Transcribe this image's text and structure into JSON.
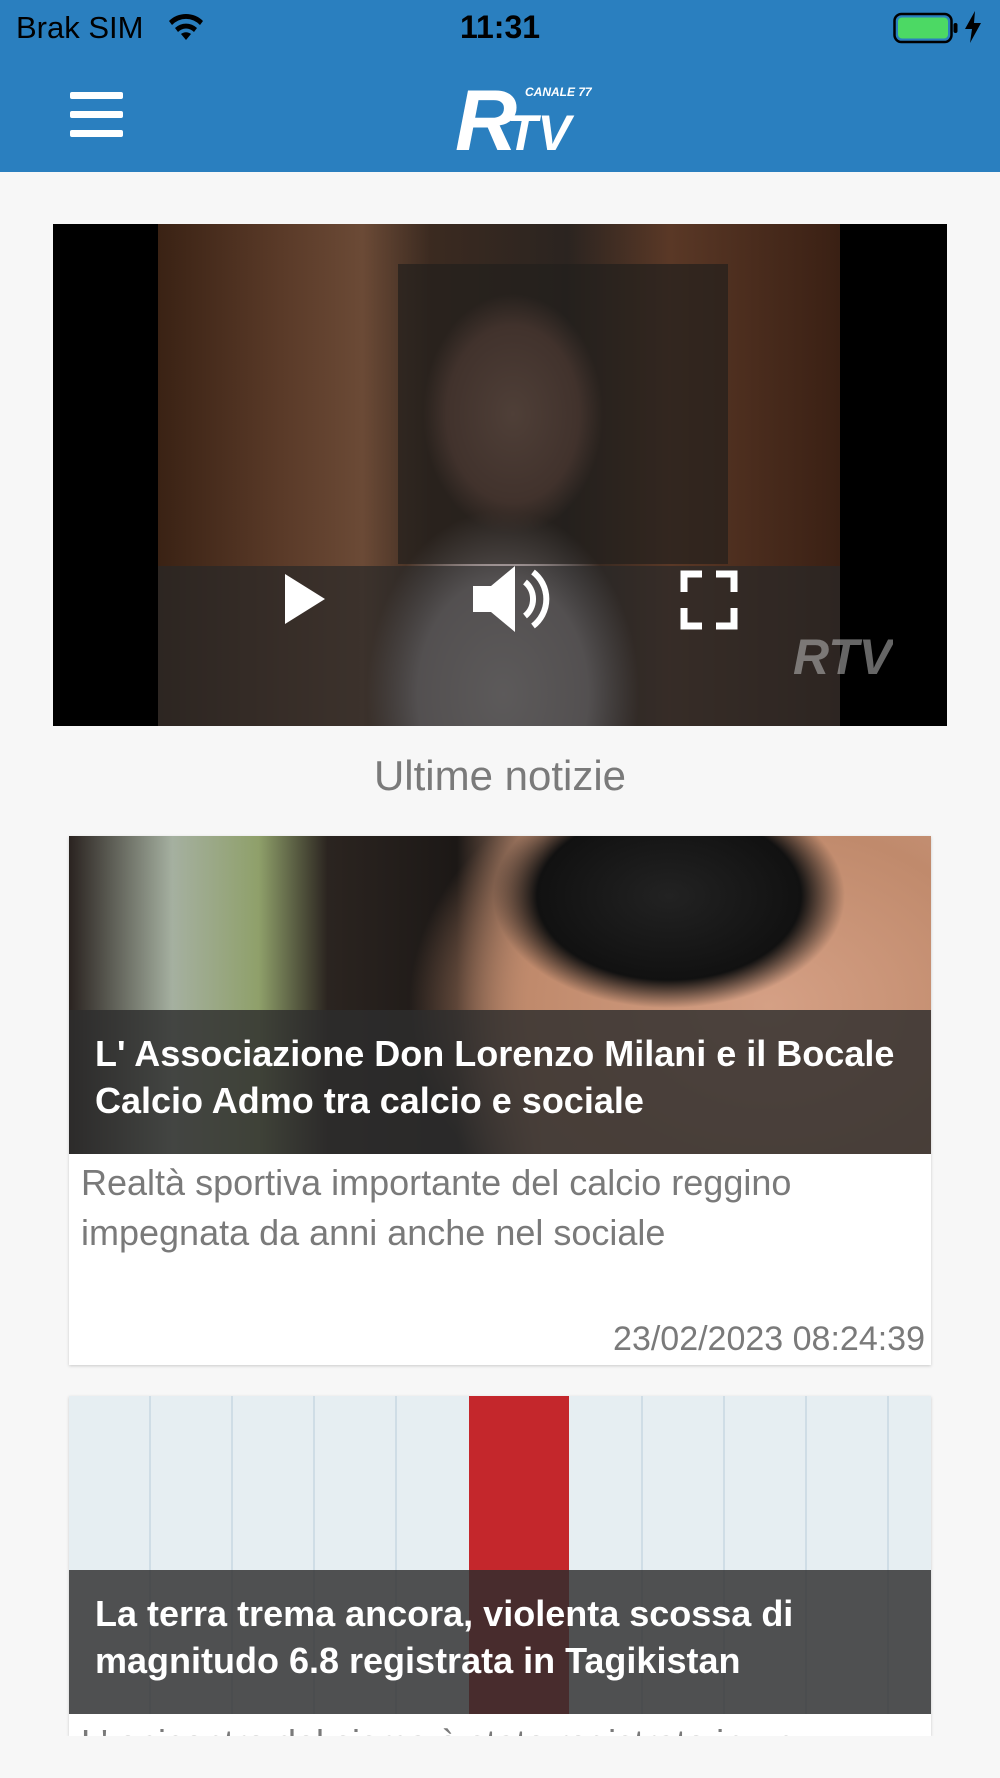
{
  "status_bar": {
    "carrier": "Brak SIM",
    "time": "11:31",
    "battery_color": "#4cd964"
  },
  "header": {
    "menu_icon": "hamburger-menu-icon",
    "logo_main": "RTV",
    "logo_sub": "CANALE 77",
    "background": "#2a7fbf"
  },
  "player": {
    "play_icon": "play-icon",
    "volume_icon": "volume-icon",
    "fullscreen_icon": "fullscreen-icon",
    "watermark": "RTV"
  },
  "section": {
    "title": "Ultime notizie"
  },
  "news": [
    {
      "title": "L' Associazione Don Lorenzo Milani e il Bocale Calcio Admo tra calcio e sociale",
      "description": "Realtà sportiva importante del calcio reggino impegnata da anni anche nel sociale",
      "date": "23/02/2023 08:24:39"
    },
    {
      "title": "La terra trema ancora, violenta scossa di magnitudo 6.8 registrata in Tagikistan",
      "description": "L' epicentro del sisma è stato registrato in un"
    }
  ]
}
